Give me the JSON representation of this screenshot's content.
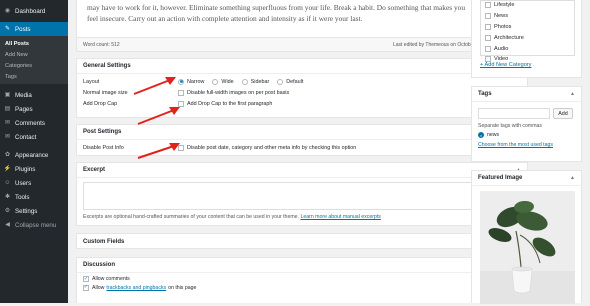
{
  "sidebar": {
    "items": [
      {
        "label": "Dashboard",
        "icon": "dashboard-icon",
        "glyph": "◉"
      },
      {
        "label": "Posts",
        "icon": "pin-icon",
        "glyph": "✎",
        "active": true
      },
      {
        "label": "Media",
        "icon": "media-icon",
        "glyph": "▣"
      },
      {
        "label": "Pages",
        "icon": "pages-icon",
        "glyph": "▤"
      },
      {
        "label": "Comments",
        "icon": "comments-icon",
        "glyph": "✉"
      },
      {
        "label": "Contact",
        "icon": "contact-icon",
        "glyph": "✉"
      },
      {
        "label": "Appearance",
        "icon": "appearance-icon",
        "glyph": "✿"
      },
      {
        "label": "Plugins",
        "icon": "plugins-icon",
        "glyph": "⚡"
      },
      {
        "label": "Users",
        "icon": "users-icon",
        "glyph": "☺"
      },
      {
        "label": "Tools",
        "icon": "tools-icon",
        "glyph": "✱"
      },
      {
        "label": "Settings",
        "icon": "settings-icon",
        "glyph": "⚙"
      },
      {
        "label": "Collapse menu",
        "icon": "collapse-icon",
        "glyph": "◀"
      }
    ],
    "posts_sub": [
      "All Posts",
      "Add New",
      "Categories",
      "Tags"
    ]
  },
  "editor": {
    "line1": "may have to work for it, however. Eliminate something superfluous from your life. Break a habit. Do something that makes you",
    "line2": "feel insecure. Carry out an action with complete attention and intensity as if it were your last.",
    "word_count": "Word count: 512",
    "last_edited": "Last edited by Themeous on October 25, 2017 at 6:17 pm"
  },
  "general": {
    "title": "General Settings",
    "layout_label": "Layout",
    "layout_options": [
      "Narrow",
      "Wide",
      "Sidebar",
      "Default"
    ],
    "layout_selected": "Narrow",
    "image_label": "Normal image size",
    "image_option": "Disable full-width images on per post basis",
    "dropcap_label": "Add Drop Cap",
    "dropcap_option": "Add Drop Cap to the first paragraph"
  },
  "post_settings": {
    "title": "Post Settings",
    "info_label": "Disable Post Info",
    "info_option": "Disable post date, category and other meta info by checking this option"
  },
  "excerpt": {
    "title": "Excerpt",
    "help": "Excerpts are optional hand-crafted summaries of your content that can be used in your theme.",
    "help_link": "Learn more about manual excerpts"
  },
  "custom_fields": {
    "title": "Custom Fields"
  },
  "discussion": {
    "title": "Discussion",
    "allow_comments": "Allow comments",
    "allow_prefix": "Allow",
    "trackbacks_link": "trackbacks and pingbacks",
    "allow_suffix": "on this page"
  },
  "categories": {
    "items": [
      "Lifestyle",
      "News",
      "Photos",
      "Architecture",
      "Audio",
      "Video"
    ],
    "add_new": "+ Add New Category"
  },
  "tags": {
    "title": "Tags",
    "add_button": "Add",
    "hint": "Separate tags with commas",
    "tag": "news",
    "choose": "Choose from the most used tags"
  },
  "featured": {
    "title": "Featured Image"
  },
  "colors": {
    "accent": "#0073aa",
    "arrow": "#e2231a",
    "sidebar": "#23282d"
  }
}
